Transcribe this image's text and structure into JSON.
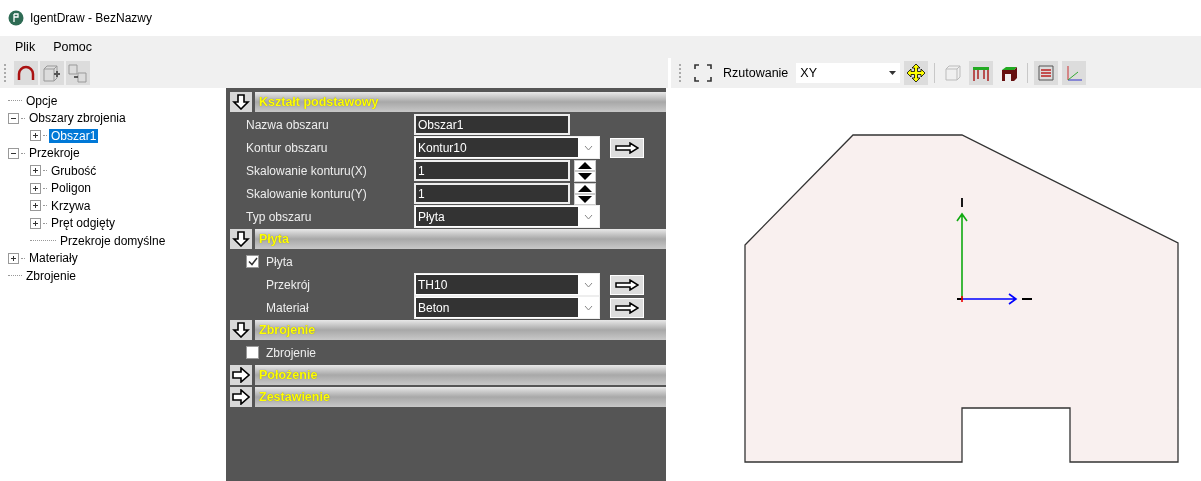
{
  "window": {
    "title": "IgentDraw - BezNazwy"
  },
  "menu": [
    "Plik",
    "Pomoc"
  ],
  "viewport_toolbar": {
    "label": "Rzutowanie",
    "value": "XY"
  },
  "tree": [
    {
      "label": "Opcje",
      "kind": "leaf",
      "selected": false
    },
    {
      "label": "Obszary zbrojenia",
      "kind": "node",
      "expanded": true,
      "selected": false,
      "children": [
        {
          "label": "Obszar1",
          "kind": "node",
          "expanded": false,
          "selected": true
        }
      ]
    },
    {
      "label": "Przekroje",
      "kind": "node",
      "expanded": true,
      "selected": false,
      "children": [
        {
          "label": "Grubość",
          "kind": "node",
          "expanded": false,
          "selected": false
        },
        {
          "label": "Poligon",
          "kind": "node",
          "expanded": false,
          "selected": false
        },
        {
          "label": "Krzywa",
          "kind": "node",
          "expanded": false,
          "selected": false
        },
        {
          "label": "Pręt odgięty",
          "kind": "node",
          "expanded": false,
          "selected": false
        },
        {
          "label": "Przekroje domyślne",
          "kind": "leaf",
          "selected": false
        }
      ]
    },
    {
      "label": "Materiały",
      "kind": "node",
      "expanded": false,
      "selected": false
    },
    {
      "label": "Zbrojenie",
      "kind": "leaf",
      "selected": false
    }
  ],
  "sections": [
    {
      "title": "Kształt podstawowy",
      "expanded": true,
      "rows": [
        {
          "kind": "text",
          "label": "Nazwa obszaru",
          "value": "Obszar1"
        },
        {
          "kind": "select",
          "label": "Kontur obszaru",
          "value": "Kontur10",
          "go_button": true
        },
        {
          "kind": "spin",
          "label": "Skalowanie konturu(X)",
          "value": "1"
        },
        {
          "kind": "spin",
          "label": "Skalowanie konturu(Y)",
          "value": "1"
        },
        {
          "kind": "select",
          "label": "Typ obszaru",
          "value": "Płyta",
          "go_button": false
        }
      ]
    },
    {
      "title": "Płyta",
      "expanded": true,
      "rows": [
        {
          "kind": "checkbox",
          "label": "Płyta",
          "checked": true,
          "children": [
            {
              "kind": "select",
              "label": "Przekrój",
              "value": "TH10",
              "go_button": true
            },
            {
              "kind": "select",
              "label": "Materiał",
              "value": "Beton",
              "go_button": true
            }
          ]
        }
      ]
    },
    {
      "title": "Zbrojenie",
      "expanded": true,
      "rows": [
        {
          "kind": "checkbox",
          "label": "Zbrojenie",
          "checked": false
        }
      ]
    },
    {
      "title": "Położenie",
      "expanded": false
    },
    {
      "title": "Zestawienie",
      "expanded": false
    }
  ]
}
